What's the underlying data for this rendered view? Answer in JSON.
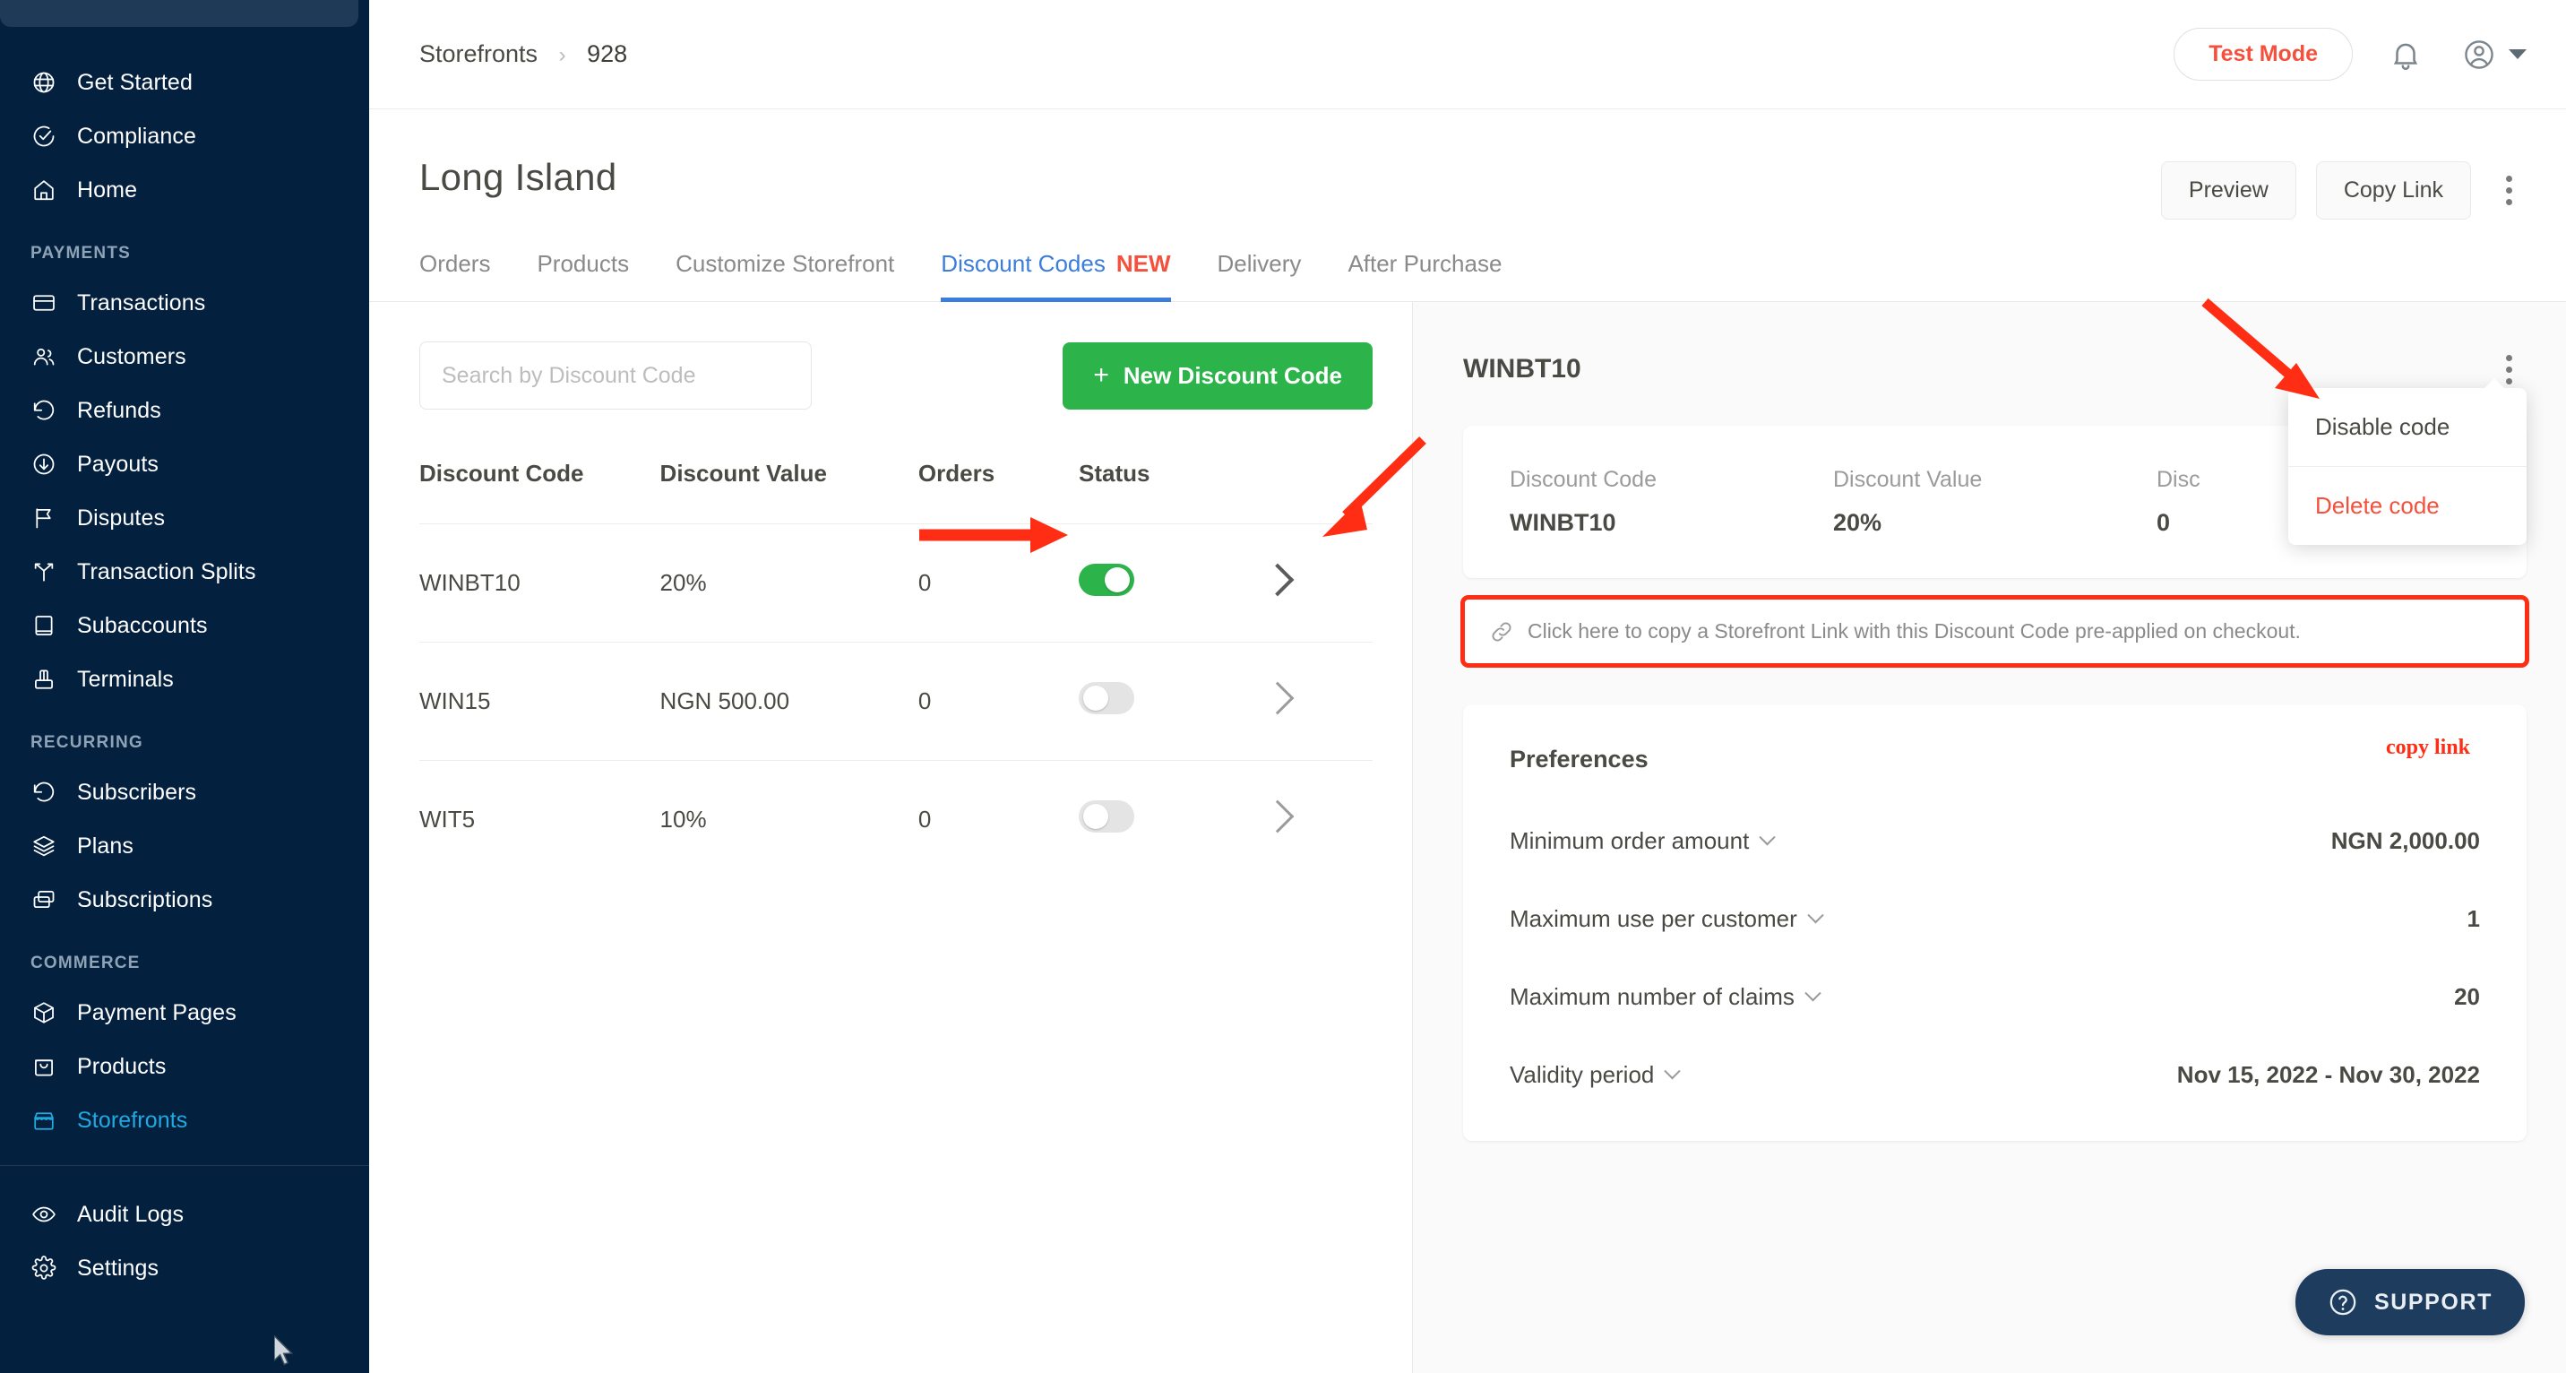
{
  "sidebar": {
    "groups": [
      {
        "label": "",
        "items": [
          {
            "label": "Get Started",
            "icon": "globe-icon"
          },
          {
            "label": "Compliance",
            "icon": "check-circle-icon"
          },
          {
            "label": "Home",
            "icon": "home-icon"
          }
        ]
      },
      {
        "label": "PAYMENTS",
        "items": [
          {
            "label": "Transactions",
            "icon": "card-icon"
          },
          {
            "label": "Customers",
            "icon": "users-icon"
          },
          {
            "label": "Refunds",
            "icon": "refund-icon"
          },
          {
            "label": "Payouts",
            "icon": "payout-icon"
          },
          {
            "label": "Disputes",
            "icon": "flag-icon"
          },
          {
            "label": "Transaction Splits",
            "icon": "split-icon"
          },
          {
            "label": "Subaccounts",
            "icon": "book-icon"
          },
          {
            "label": "Terminals",
            "icon": "terminal-icon"
          }
        ]
      },
      {
        "label": "RECURRING",
        "items": [
          {
            "label": "Subscribers",
            "icon": "refund-icon"
          },
          {
            "label": "Plans",
            "icon": "layers-icon"
          },
          {
            "label": "Subscriptions",
            "icon": "copy-cards-icon"
          }
        ]
      },
      {
        "label": "COMMERCE",
        "items": [
          {
            "label": "Payment Pages",
            "icon": "box-icon"
          },
          {
            "label": "Products",
            "icon": "bag-icon"
          },
          {
            "label": "Storefronts",
            "icon": "storefront-icon",
            "active": true
          }
        ]
      }
    ],
    "footer_items": [
      {
        "label": "Audit Logs",
        "icon": "eye-icon"
      },
      {
        "label": "Settings",
        "icon": "gear-icon"
      }
    ],
    "active_color": "#21a9e1"
  },
  "topbar": {
    "breadcrumb_root": "Storefronts",
    "breadcrumb_sep": "›",
    "breadcrumb_current": "928",
    "test_mode_label": "Test Mode",
    "test_mode_color": "#f4503c",
    "bell_icon": "bell-icon",
    "avatar_icon": "user-avatar-icon"
  },
  "page": {
    "title": "Long Island",
    "preview_label": "Preview",
    "copy_link_label": "Copy Link",
    "more_icon": "kebab-menu-icon"
  },
  "tabs": [
    {
      "label": "Orders",
      "active": false
    },
    {
      "label": "Products",
      "active": false
    },
    {
      "label": "Customize Storefront",
      "active": false
    },
    {
      "label": "Discount Codes",
      "badge": "NEW",
      "active": true
    },
    {
      "label": "Delivery",
      "active": false
    },
    {
      "label": "After Purchase",
      "active": false
    }
  ],
  "list": {
    "search_placeholder": "Search by Discount Code",
    "search_value": "",
    "new_button_label": "New Discount Code",
    "new_button_plus": "+",
    "new_button_color": "#2cb34a",
    "columns": [
      "Discount Code",
      "Discount Value",
      "Orders",
      "Status"
    ],
    "rows": [
      {
        "code": "WINBT10",
        "value": "20%",
        "orders": "0",
        "enabled": true
      },
      {
        "code": "WIN15",
        "value": "NGN 500.00",
        "orders": "0",
        "enabled": false
      },
      {
        "code": "WIT5",
        "value": "10%",
        "orders": "0",
        "enabled": false
      }
    ]
  },
  "detail": {
    "title": "WINBT10",
    "more_icon": "kebab-menu-icon",
    "summary": [
      {
        "label": "Discount Code",
        "value": "WINBT10"
      },
      {
        "label": "Discount Value",
        "value": "20%"
      },
      {
        "label": "Disc",
        "value": "0"
      }
    ],
    "copy_banner_text": "Click here to copy a Storefront Link with this Discount Code pre-applied on checkout.",
    "copy_banner_icon": "link-icon",
    "preferences_title": "Preferences",
    "preferences": [
      {
        "label": "Minimum order amount",
        "value": "NGN 2,000.00"
      },
      {
        "label": "Maximum use per customer",
        "value": "1"
      },
      {
        "label": "Maximum number of claims",
        "value": "20"
      },
      {
        "label": "Validity period",
        "value": "Nov 15, 2022  -  Nov 30, 2022"
      }
    ]
  },
  "dropdown": {
    "items": [
      {
        "label": "Disable code",
        "danger": false
      },
      {
        "label": "Delete code",
        "danger": true
      }
    ]
  },
  "support": {
    "label": "SUPPORT",
    "icon": "question-circle-icon"
  },
  "annotations": {
    "copy_link_note": "copy link",
    "color": "#ff2d13"
  }
}
